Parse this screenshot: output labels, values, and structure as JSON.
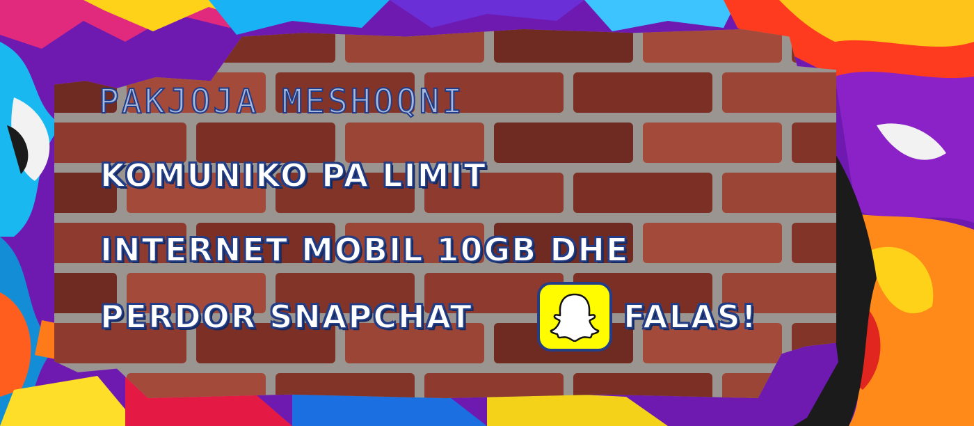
{
  "banner": {
    "title": "PAKJOJA MESHOQNI",
    "line1": "KOMUNIKO PA LIMIT",
    "line2": "INTERNET MOBIL 10GB DHE",
    "line3_pre": "PERDOR SNAPCHAT",
    "line3_post": "FALAS!",
    "icon": "snapchat-ghost-icon"
  },
  "colors": {
    "title_fill": "#a7b8da",
    "text_fill": "#ffffff",
    "outline": "#233e86",
    "snapchat_yellow": "#fffc00",
    "brick": "#8e3a2e",
    "mortar": "#9a9590"
  }
}
